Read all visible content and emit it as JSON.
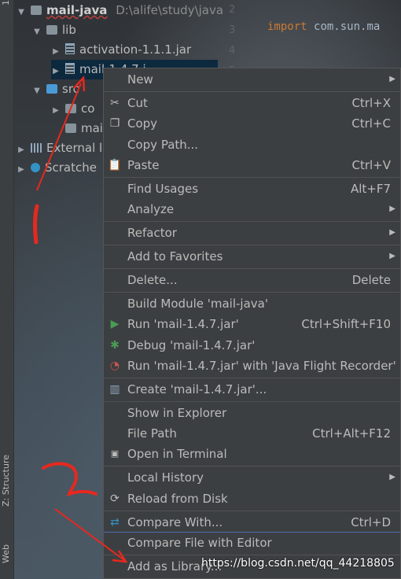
{
  "side_tabs": {
    "top": "1",
    "structure": "Z: Structure",
    "web": "Web"
  },
  "tree": {
    "project_name": "mail-java",
    "project_path": "D:\\alife\\study\\java",
    "lib": "lib",
    "activation": "activation-1.1.1.jar",
    "mail_jar": "mail-1.4.7.j",
    "src": "src",
    "co": "co",
    "mail_iml": "mail-j",
    "external": "External l",
    "scratches": "Scratche"
  },
  "editor": {
    "gutter": [
      "2",
      "3",
      "4",
      "5"
    ],
    "import_keyword": "import",
    "import_path": "com.sun.ma"
  },
  "menu": {
    "new": "New",
    "cut": "Cut",
    "cut_sc": "Ctrl+X",
    "copy": "Copy",
    "copy_sc": "Ctrl+C",
    "copy_path": "Copy Path...",
    "paste": "Paste",
    "paste_sc": "Ctrl+V",
    "find_usages": "Find Usages",
    "find_usages_sc": "Alt+F7",
    "analyze": "Analyze",
    "refactor": "Refactor",
    "add_fav": "Add to Favorites",
    "delete": "Delete...",
    "delete_sc": "Delete",
    "build_module": "Build Module 'mail-java'",
    "run": "Run 'mail-1.4.7.jar'",
    "run_sc": "Ctrl+Shift+F10",
    "debug": "Debug 'mail-1.4.7.jar'",
    "run_jfr": "Run 'mail-1.4.7.jar' with 'Java Flight Recorder'",
    "create": "Create 'mail-1.4.7.jar'...",
    "show_explorer": "Show in Explorer",
    "file_path": "File Path",
    "file_path_sc": "Ctrl+Alt+F12",
    "open_terminal": "Open in Terminal",
    "local_history": "Local History",
    "reload": "Reload from Disk",
    "compare_with": "Compare With...",
    "compare_with_sc": "Ctrl+D",
    "compare_file": "Compare File with Editor",
    "add_library": "Add as Library..."
  },
  "annotations": {
    "mark1": "1",
    "mark2": "2"
  },
  "watermark": "https://blog.csdn.net/qq_44218805",
  "colors": {
    "menu_bg": "#3c3f41",
    "run_green": "#499c54",
    "debug_green": "#499c54",
    "accent_blue": "#4b6eaf",
    "annotation_red": "#e8281e"
  }
}
